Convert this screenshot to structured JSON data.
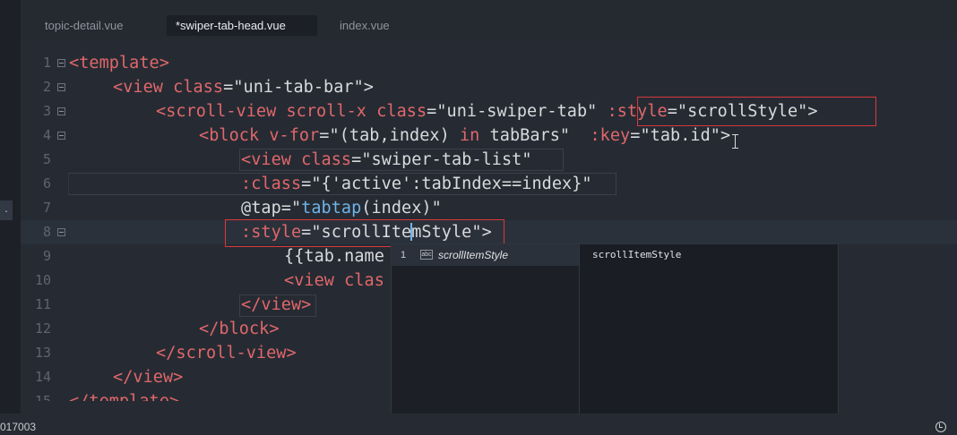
{
  "tabs": [
    {
      "label": "topic-detail.vue"
    },
    {
      "label": "*swiper-tab-head.vue"
    },
    {
      "label": "index.vue"
    }
  ],
  "side_marker": ".",
  "lines": [
    {
      "num": "1"
    },
    {
      "num": "2"
    },
    {
      "num": "3"
    },
    {
      "num": "4"
    },
    {
      "num": "5"
    },
    {
      "num": "6"
    },
    {
      "num": "7"
    },
    {
      "num": "8"
    },
    {
      "num": "9"
    },
    {
      "num": "10"
    },
    {
      "num": "11"
    },
    {
      "num": "12"
    },
    {
      "num": "13"
    },
    {
      "num": "14"
    },
    {
      "num": "15"
    }
  ],
  "code": {
    "l1": {
      "tag": "<template>"
    },
    "l2": {
      "open": "<view",
      "attr": "class",
      "eq": "=",
      "val": "\"uni-tab-bar\"",
      "close": ">"
    },
    "l3": {
      "open": "<scroll-view",
      "attr1": "scroll-x",
      "attr2": "class",
      "eq": "=",
      "val": "\"uni-swiper-tab\"",
      "battr": ":style",
      "bval": "\"scrollStyle\"",
      "close": ">"
    },
    "l4": {
      "open": "<block",
      "attr1": "v-for",
      "val1a": "\"(tab,index)",
      "kw": "in",
      "val1b": "tabBars\"",
      "attr2": ":key",
      "val2a": "\"tab.i",
      "val2b": "d\"",
      "close": ">"
    },
    "l5": {
      "open": "<view",
      "attr": "class",
      "val": "\"swiper-tab-list\""
    },
    "l6": {
      "attr": ":class",
      "val": "\"{'active':tabIndex==index}\""
    },
    "l7": {
      "attr": "@tap",
      "eq": "=\"",
      "fn": "tabtap",
      "args": "(index)\""
    },
    "l8": {
      "attr": ":style",
      "vala": "\"scrollIte",
      "valb": "mStyle\"",
      "close": ">"
    },
    "l9": {
      "text": "{{tab.name"
    },
    "l10": {
      "open": "<view",
      "attr": "clas"
    },
    "l11": {
      "tag": "</view>"
    },
    "l12": {
      "tag": "</block>"
    },
    "l13": {
      "tag": "</scroll-view>"
    },
    "l14": {
      "tag": "</view>"
    },
    "l15": {
      "tag": "</template>"
    }
  },
  "autocomplete": {
    "index": "1",
    "icon": "abc",
    "label": "scrollItemStyle",
    "detail": "scrollItemStyle"
  },
  "status": {
    "left_text": "017003"
  }
}
